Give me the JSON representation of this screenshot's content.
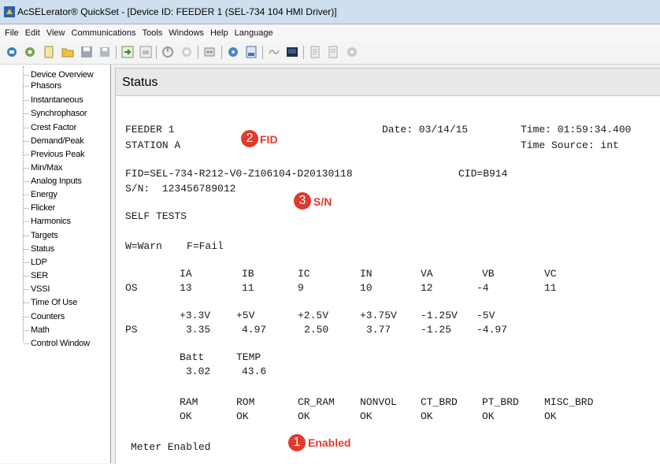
{
  "window": {
    "title": "AcSELerator® QuickSet - [Device ID: FEEDER 1 (SEL-734 104 HMI Driver)]"
  },
  "menu": [
    "File",
    "Edit",
    "View",
    "Communications",
    "Tools",
    "Windows",
    "Help",
    "Language"
  ],
  "sidebar": {
    "items": [
      "Device Overview",
      "Phasors",
      "Instantaneous",
      "Synchrophasor",
      "Crest Factor",
      "Demand/Peak",
      "Previous Peak",
      "Min/Max",
      "Analog Inputs",
      "Energy",
      "Flicker",
      "Harmonics",
      "Targets",
      "Status",
      "LDP",
      "SER",
      "VSSI",
      "Time Of Use",
      "Counters",
      "Math",
      "Control Window"
    ]
  },
  "status": {
    "title": "Status",
    "device_name": "FEEDER 1",
    "station": "STATION A",
    "date": "Date: 03/14/15",
    "time": "Time: 01:59:34.400",
    "time_source": "Time Source: int",
    "fid": "FID=SEL-734-R212-V0-Z106104-D20130118",
    "cid": "CID=B914",
    "serial": "S/N:  123456789012",
    "self_tests_label": "SELF TESTS",
    "legend": "W=Warn    F=Fail",
    "os_header": [
      "IA",
      "IB",
      "IC",
      "IN",
      "VA",
      "VB",
      "VC"
    ],
    "os_label": "OS",
    "os_values": [
      "13",
      "11",
      "9",
      "10",
      "12",
      "-4",
      "11"
    ],
    "ps_header": [
      "+3.3V",
      "+5V",
      "+2.5V",
      "+3.75V",
      "-1.25V",
      "-5V"
    ],
    "ps_label": "PS",
    "ps_values": [
      "3.35",
      "4.97",
      "2.50",
      "3.77",
      "-1.25",
      "-4.97"
    ],
    "batt_header": [
      "Batt",
      "TEMP"
    ],
    "batt_values": [
      "3.02",
      "43.6"
    ],
    "mem_header": [
      "RAM",
      "ROM",
      "CR_RAM",
      "NONVOL",
      "CT_BRD",
      "PT_BRD",
      "MISC_BRD"
    ],
    "mem_values": [
      "OK",
      "OK",
      "OK",
      "OK",
      "OK",
      "OK",
      "OK"
    ],
    "meter": "Meter Enabled"
  },
  "annotations": [
    {
      "number": "1",
      "label": "Enabled"
    },
    {
      "number": "2",
      "label": "FID"
    },
    {
      "number": "3",
      "label": "S/N"
    }
  ],
  "colors": {
    "annotation": "#df3a2d",
    "titlebar": "#cfdff0"
  },
  "toolbar": {
    "icons": [
      "connect-icon",
      "settings-icon",
      "document-icon",
      "open-folder-icon",
      "save-icon",
      "save-all-icon",
      "send-icon",
      "read-icon",
      "power-icon",
      "stop-icon",
      "device-icon",
      "terminal-icon",
      "import-icon",
      "waveform-icon",
      "hmi-icon",
      "report-icon",
      "list-icon",
      "gear-icon"
    ]
  }
}
